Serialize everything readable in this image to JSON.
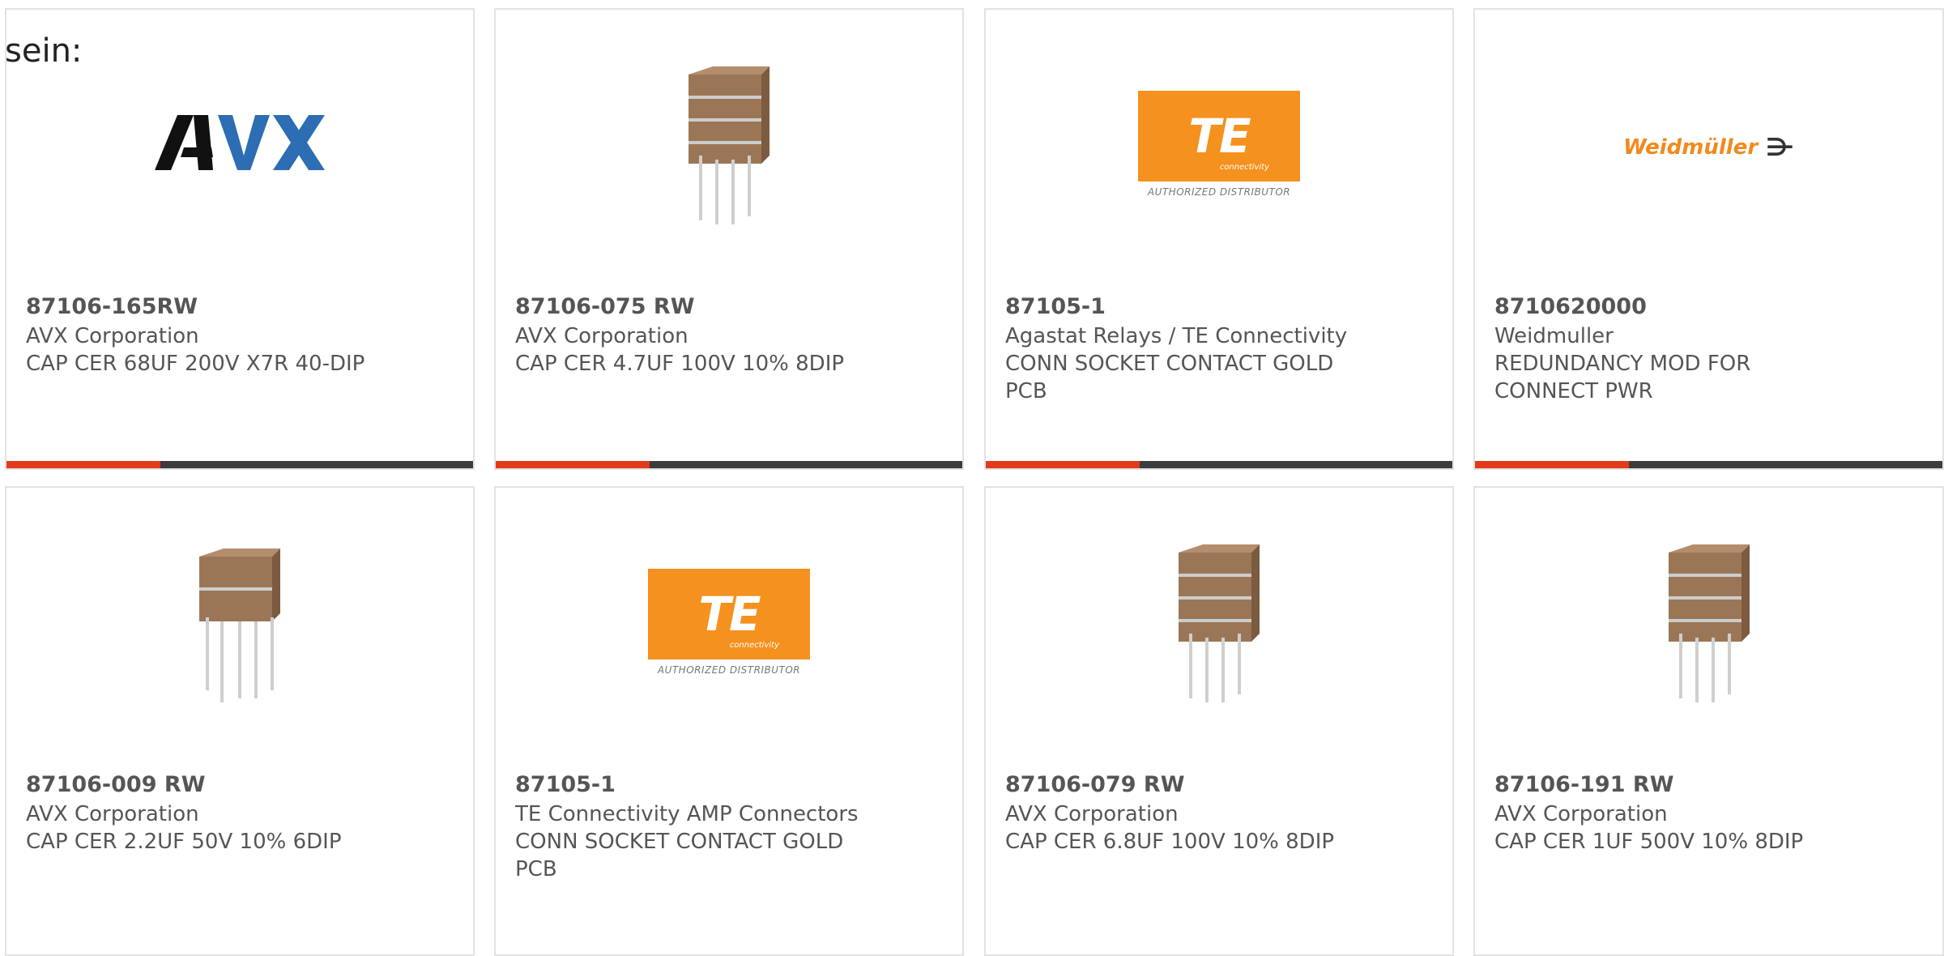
{
  "intro_text": "sein:",
  "cards": [
    {
      "part": "87106-165RW",
      "manufacturer": "AVX Corporation",
      "description": "CAP CER 68UF 200V X7R 40-DIP",
      "image": "avx-logo",
      "progress_pct": 33
    },
    {
      "part": "87106-075 RW",
      "manufacturer": "AVX Corporation",
      "description": "CAP CER 4.7UF 100V 10% 8DIP",
      "image": "capacitor-stack-photo",
      "progress_pct": 33
    },
    {
      "part": "87105-1",
      "manufacturer": "Agastat Relays / TE Connectivity",
      "description": "CONN SOCKET CONTACT GOLD PCB",
      "image": "te-logo",
      "progress_pct": 33
    },
    {
      "part": "8710620000",
      "manufacturer": "Weidmuller",
      "description": "REDUNDANCY MOD FOR CONNECT PWR",
      "image": "weidmuller-logo",
      "progress_pct": 33
    },
    {
      "part": "87106-009 RW",
      "manufacturer": "AVX Corporation",
      "description": "CAP CER 2.2UF 50V 10% 6DIP",
      "image": "capacitor-photo",
      "progress_pct": null
    },
    {
      "part": "87105-1",
      "manufacturer": "TE Connectivity AMP Connectors",
      "description": "CONN SOCKET CONTACT GOLD PCB",
      "image": "te-logo",
      "progress_pct": null
    },
    {
      "part": "87106-079 RW",
      "manufacturer": "AVX Corporation",
      "description": "CAP CER 6.8UF 100V 10% 8DIP",
      "image": "capacitor-stack-photo",
      "progress_pct": null
    },
    {
      "part": "87106-191 RW",
      "manufacturer": "AVX Corporation",
      "description": "CAP CER 1UF 500V 10% 8DIP",
      "image": "capacitor-stack-photo",
      "progress_pct": null
    }
  ],
  "logos": {
    "te_text": "TE",
    "te_sub": "connectivity",
    "te_authorized": "AUTHORIZED DISTRIBUTOR",
    "weidmuller_text": "Weidmüller",
    "avx_text": "AVX"
  },
  "colors": {
    "accent": "#e23b1a",
    "bar": "#3c3c3c",
    "te_orange": "#f5911e"
  }
}
